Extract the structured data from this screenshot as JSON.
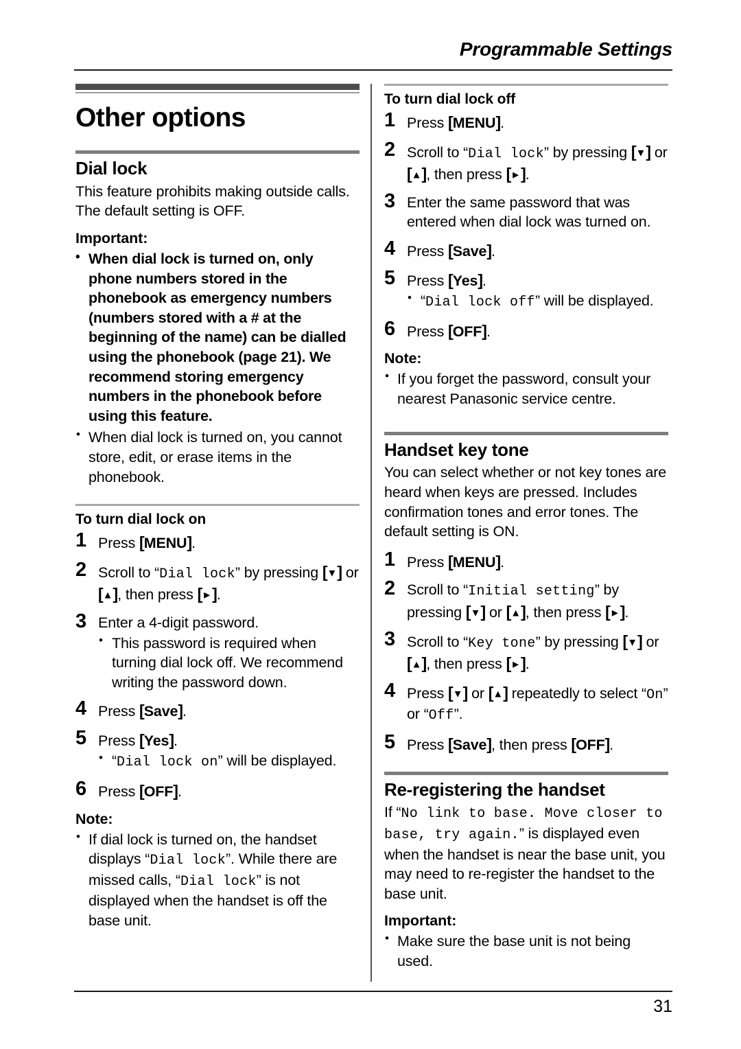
{
  "header": {
    "running_title": "Programmable Settings"
  },
  "footer": {
    "page_number": "31"
  },
  "chapter": {
    "title": "Other options"
  },
  "keys": {
    "menu": "MENU",
    "save": "Save",
    "yes": "Yes",
    "off": "OFF",
    "down": "▼",
    "up": "▲",
    "right": "►"
  },
  "left_column": {
    "dial_lock": {
      "heading": "Dial lock",
      "intro": "This feature prohibits making outside calls. The default setting is OFF.",
      "important_label": "Important:",
      "important_bullets": [
        "When dial lock is turned on, only phone numbers stored in the phonebook as emergency numbers (numbers stored with a # at the beginning of the name) can be dialled using the phonebook (page 21). We recommend storing emergency numbers in the phonebook before using this feature.",
        "When dial lock is turned on, you cannot store, edit, or erase items in the phonebook."
      ]
    },
    "turn_on": {
      "heading": "To turn dial lock on",
      "step1_press": "Press",
      "step1_period": ".",
      "step2_scroll": "Scroll to “",
      "step2_menu": "Dial lock",
      "step2_by_pressing": "” by pressing",
      "step2_or": "or",
      "step2_then_press": ", then press",
      "step2_period": ".",
      "step3": "Enter a 4-digit password.",
      "step3_sub": "This password is required when turning dial lock off. We recommend writing the password down.",
      "step4_press": "Press",
      "step4_period": ".",
      "step5_press": "Press",
      "step5_period": ".",
      "step5_sub_open": "“",
      "step5_sub_mono": "Dial lock on",
      "step5_sub_close": "” will be displayed.",
      "step6_press": "Press",
      "step6_period": ".",
      "note_label": "Note:",
      "note_parts": {
        "a": "If dial lock is turned on, the handset displays “",
        "mono1": "Dial lock",
        "b": "”. While there are missed calls, “",
        "mono2": "Dial lock",
        "c": "” is not displayed when the handset is off the base unit."
      }
    }
  },
  "right_column": {
    "turn_off": {
      "heading": "To turn dial lock off",
      "step1_press": "Press",
      "step1_period": ".",
      "step2_scroll": "Scroll to “",
      "step2_menu": "Dial lock",
      "step2_by_pressing": "” by pressing",
      "step2_or": "or",
      "step2_then_press": ", then press",
      "step2_period": ".",
      "step3": "Enter the same password that was entered when dial lock was turned on.",
      "step4_press": "Press",
      "step4_period": ".",
      "step5_press": "Press",
      "step5_period": ".",
      "step5_sub_open": "“",
      "step5_sub_mono": "Dial lock off",
      "step5_sub_close": "” will be displayed.",
      "step6_press": "Press",
      "step6_period": ".",
      "note_label": "Note:",
      "note_bullet": "If you forget the password, consult your nearest Panasonic service centre."
    },
    "key_tone": {
      "heading": "Handset key tone",
      "intro": "You can select whether or not key tones are heard when keys are pressed. Includes confirmation tones and error tones. The default setting is ON.",
      "step1_press": "Press",
      "step1_period": ".",
      "step2_scroll": "Scroll to “",
      "step2_menu": "Initial setting",
      "step2_by": "” by pressing",
      "step2_or": "or",
      "step2_then_press": ", then press",
      "step2_period": ".",
      "step3_scroll": "Scroll to “",
      "step3_menu": "Key tone",
      "step3_by_pressing": "” by pressing",
      "step3_or": "or",
      "step3_then_press": ", then press",
      "step3_period": ".",
      "step4_press": "Press",
      "step4_or": "or",
      "step4_repeatedly": "repeatedly to select",
      "step4_on": "On",
      "step4_or_word": "or",
      "step4_off": "Off",
      "step4_period": ".",
      "step5_press": "Press",
      "step5_then_press": ", then press",
      "step5_period": "."
    },
    "re_register": {
      "heading": "Re-registering the handset",
      "body_if": "If “",
      "body_mono": "No link to base. Move closer to base, try again.",
      "body_rest": "” is displayed even when the handset is near the base unit, you may need to re-register the handset to the base unit.",
      "important_label": "Important:",
      "important_bullet": "Make sure the base unit is not being used."
    }
  }
}
